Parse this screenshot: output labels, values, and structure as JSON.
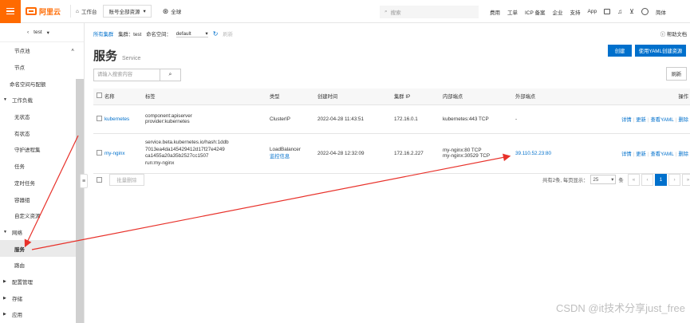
{
  "topbar": {
    "logo_text": "阿里云",
    "workbench": "工作台",
    "resource_group": "账号全部资源",
    "region": "全球",
    "search_placeholder": "搜索",
    "menu": [
      "费用",
      "工单",
      "ICP 备案",
      "企业",
      "支持",
      "App"
    ],
    "lang": "简体"
  },
  "sidebar": {
    "cluster": "test",
    "items": [
      {
        "label": "节点池",
        "type": "child",
        "active": false
      },
      {
        "label": "节点",
        "type": "child",
        "active": false
      },
      {
        "label": "命名空间与配额",
        "type": "plain",
        "active": false
      },
      {
        "label": "工作负载",
        "type": "group",
        "active": false
      },
      {
        "label": "无状态",
        "type": "child",
        "active": false
      },
      {
        "label": "有状态",
        "type": "child",
        "active": false
      },
      {
        "label": "守护进程集",
        "type": "child",
        "active": false
      },
      {
        "label": "任务",
        "type": "child",
        "active": false
      },
      {
        "label": "定时任务",
        "type": "child",
        "active": false
      },
      {
        "label": "容器组",
        "type": "child",
        "active": false
      },
      {
        "label": "自定义资源",
        "type": "child",
        "active": false
      },
      {
        "label": "网络",
        "type": "group",
        "active": false
      },
      {
        "label": "服务",
        "type": "child",
        "active": true
      },
      {
        "label": "路由",
        "type": "child",
        "active": false
      },
      {
        "label": "配置管理",
        "type": "groupc",
        "active": false
      },
      {
        "label": "存储",
        "type": "groupc",
        "active": false
      },
      {
        "label": "应用",
        "type": "groupc",
        "active": false
      }
    ]
  },
  "main": {
    "breadcrumb_all": "所有集群",
    "breadcrumb_cluster_label": "集群：",
    "breadcrumb_cluster": "test",
    "ns_label": "命名空间：",
    "ns_value": "default",
    "refresh_small": "刷新",
    "help": "帮助文档",
    "title": "服务",
    "title_en": "Service",
    "create_btn": "创建",
    "yaml_btn": "使用YAML创建资源",
    "search_placeholder": "请输入搜索内容",
    "refresh_btn": "刷新",
    "columns": [
      "名称",
      "标签",
      "类型",
      "创建时间",
      "集群 IP",
      "内部端点",
      "外部端点",
      "操作"
    ],
    "rows": [
      {
        "name": "kubernetes",
        "labels": [
          "component:apiserver",
          "provider:kubernetes"
        ],
        "type": "ClusterIP",
        "type_link": "",
        "created": "2022-04-28 11:43:51",
        "cluster_ip": "172.16.0.1",
        "internal": [
          "kubernetes:443 TCP"
        ],
        "external": "-"
      },
      {
        "name": "my-nginx",
        "labels": [
          "service.beta.kubernetes.io/hash:1ddb",
          "7013ea4da145429412d17f27e4249",
          "ca1455a20a35b2527cc1507",
          "run:my-nginx"
        ],
        "type": "LoadBalancer",
        "type_link": "监控信息",
        "created": "2022-04-28 12:32:09",
        "cluster_ip": "172.16.2.227",
        "internal": [
          "my-nginx:80 TCP",
          "my-nginx:30529 TCP"
        ],
        "external": "39.110.52.23:80"
      }
    ],
    "ops": [
      "详情",
      "更新",
      "查看YAML",
      "删除"
    ],
    "batch_delete": "批量删除",
    "total_text": "共有2条, 每页显示：",
    "page_size": "25",
    "page_unit": "条",
    "pages": [
      "«",
      "‹",
      "1",
      "›",
      "»"
    ],
    "current_page": "1"
  },
  "watermark": "CSDN @it技术分享just_free",
  "colors": {
    "brand": "#ff6a00",
    "primary": "#0070cc",
    "annotation": "#e8312a"
  }
}
